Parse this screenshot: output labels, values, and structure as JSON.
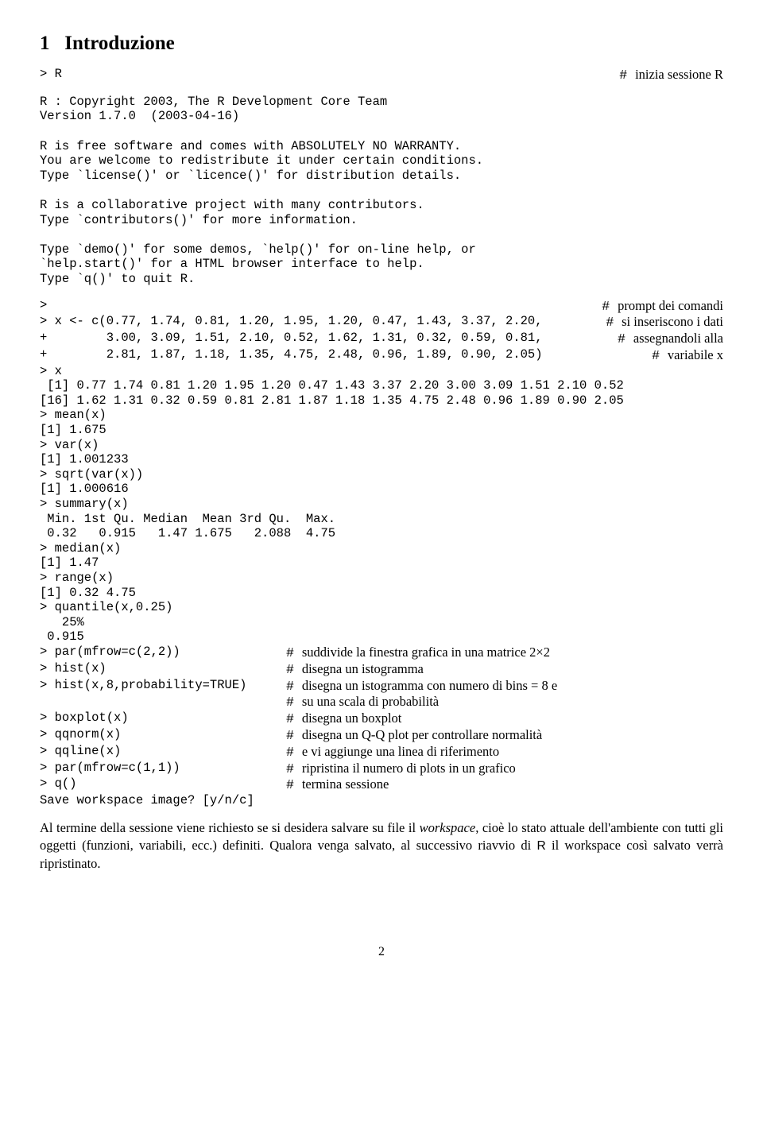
{
  "section": {
    "number": "1",
    "title": "Introduzione"
  },
  "line1": {
    "code": "> R",
    "comment": "inizia sessione R"
  },
  "banner": [
    "R : Copyright 2003, The R Development Core Team",
    "Version 1.7.0  (2003-04-16)",
    "",
    "R is free software and comes with ABSOLUTELY NO WARRANTY.",
    "You are welcome to redistribute it under certain conditions.",
    "Type `license()' or `licence()' for distribution details.",
    "",
    "R is a collaborative project with many contributors.",
    "Type `contributors()' for more information.",
    "",
    "Type `demo()' for some demos, `help()' for on-line help, or",
    "`help.start()' for a HTML browser interface to help.",
    "Type `q()' to quit R."
  ],
  "block2": [
    {
      "code": ">",
      "comment": "prompt dei comandi"
    },
    {
      "code": "> x <- c(0.77, 1.74, 0.81, 1.20, 1.95, 1.20, 0.47, 1.43, 3.37, 2.20,",
      "comment": "si inseriscono i dati"
    },
    {
      "code": "+        3.00, 3.09, 1.51, 2.10, 0.52, 1.62, 1.31, 0.32, 0.59, 0.81,",
      "comment": "assegnandoli alla"
    },
    {
      "code": "+        2.81, 1.87, 1.18, 1.35, 4.75, 2.48, 0.96, 1.89, 0.90, 2.05)",
      "comment": "variabile x"
    }
  ],
  "output1": [
    "> x",
    " [1] 0.77 1.74 0.81 1.20 1.95 1.20 0.47 1.43 3.37 2.20 3.00 3.09 1.51 2.10 0.52",
    "[16] 1.62 1.31 0.32 0.59 0.81 2.81 1.87 1.18 1.35 4.75 2.48 0.96 1.89 0.90 2.05",
    "> mean(x)",
    "[1] 1.675",
    "> var(x)",
    "[1] 1.001233",
    "> sqrt(var(x))",
    "[1] 1.000616",
    "> summary(x)",
    " Min. 1st Qu. Median  Mean 3rd Qu.  Max.",
    " 0.32   0.915   1.47 1.675   2.088  4.75",
    "> median(x)",
    "[1] 1.47",
    "> range(x)",
    "[1] 0.32 4.75",
    "> quantile(x,0.25)",
    "   25%",
    " 0.915"
  ],
  "block3": [
    {
      "code": "> par(mfrow=c(2,2))",
      "comment": "suddivide la finestra grafica in una matrice 2×2"
    },
    {
      "code": "> hist(x)",
      "comment": "disegna un istogramma"
    },
    {
      "code": "> hist(x,8,probability=TRUE)",
      "comment": "disegna un istogramma con numero di bins = 8 e"
    },
    {
      "code": "",
      "comment": "su una scala di probabilità"
    },
    {
      "code": "> boxplot(x)",
      "comment": "disegna un boxplot"
    },
    {
      "code": "> qqnorm(x)",
      "comment": "disegna un Q-Q plot per controllare normalità"
    },
    {
      "code": "> qqline(x)",
      "comment": "e vi aggiunge una linea di riferimento"
    },
    {
      "code": "> par(mfrow=c(1,1))",
      "comment": "ripristina il numero di plots in un grafico"
    },
    {
      "code": "> q()",
      "comment": "termina sessione"
    }
  ],
  "tail": "Save workspace image? [y/n/c]",
  "para": {
    "p1a": "Al termine della sessione viene richiesto se si desidera salvare su file il ",
    "p1b": "workspace",
    "p1c": ", cioè lo stato attuale dell'ambiente con tutti gli oggetti (funzioni, variabili, ecc.) definiti. Qualora venga salvato, al successivo riavvio di ",
    "p1d": "R",
    "p1e": " il workspace così salvato verrà ripristinato."
  },
  "page": "2"
}
